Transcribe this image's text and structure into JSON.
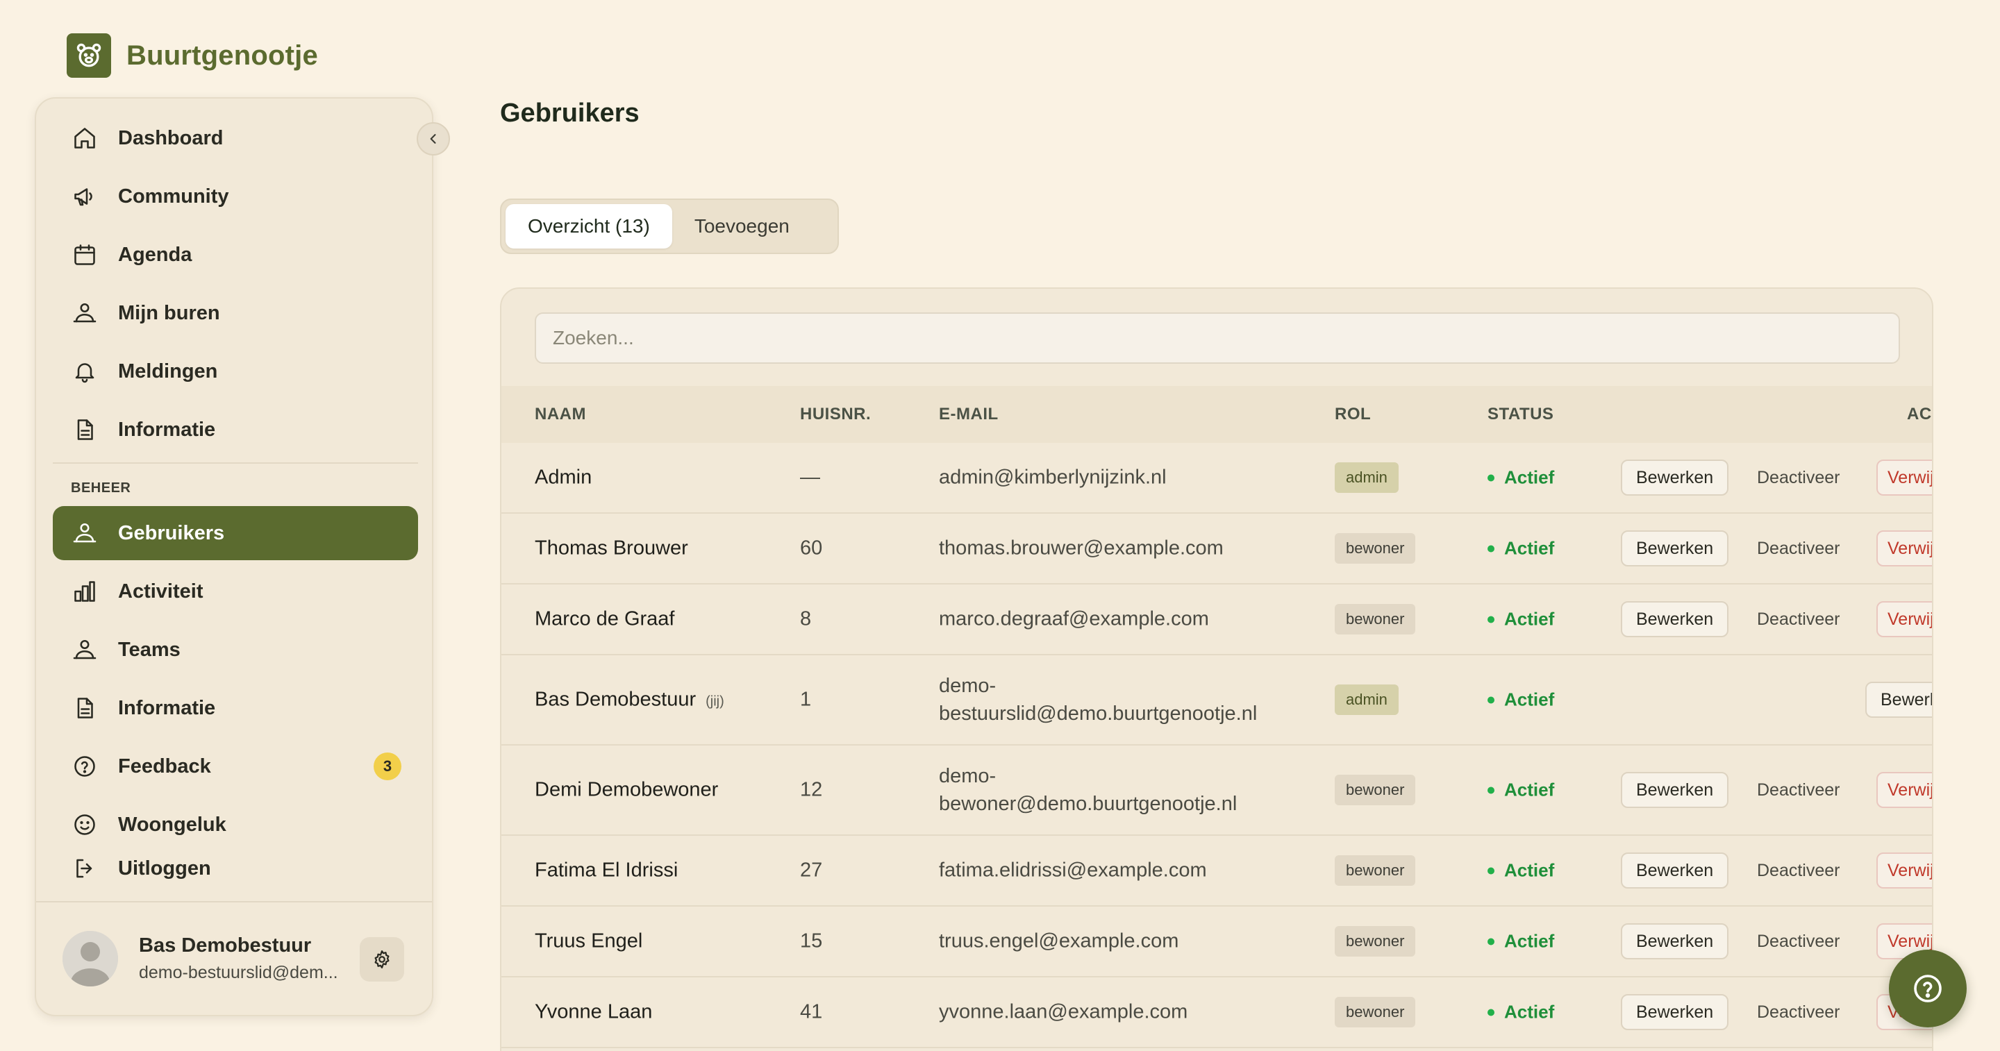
{
  "app": {
    "name": "Buurtgenootje"
  },
  "sidebar": {
    "items": [
      {
        "label": "Dashboard",
        "icon": "home-icon"
      },
      {
        "label": "Community",
        "icon": "megaphone-icon"
      },
      {
        "label": "Agenda",
        "icon": "calendar-icon"
      },
      {
        "label": "Mijn buren",
        "icon": "people-icon"
      },
      {
        "label": "Meldingen",
        "icon": "bell-icon"
      },
      {
        "label": "Informatie",
        "icon": "document-icon"
      }
    ],
    "section_title": "BEHEER",
    "admin_items": [
      {
        "label": "Gebruikers",
        "icon": "people-icon",
        "active": true
      },
      {
        "label": "Activiteit",
        "icon": "bar-chart-icon"
      },
      {
        "label": "Teams",
        "icon": "people-icon"
      },
      {
        "label": "Informatie",
        "icon": "document-icon"
      },
      {
        "label": "Feedback",
        "icon": "help-circle-icon",
        "badge": "3"
      },
      {
        "label": "Woongeluk",
        "icon": "smiley-icon"
      }
    ],
    "logout_label": "Uitloggen",
    "profile": {
      "name": "Bas Demobestuur",
      "email": "demo-bestuurslid@dem..."
    }
  },
  "main": {
    "title": "Gebruikers",
    "tabs": [
      {
        "label": "Overzicht (13)",
        "active": true
      },
      {
        "label": "Toevoegen"
      }
    ],
    "search_placeholder": "Zoeken...",
    "columns": {
      "name": "NAAM",
      "nr": "HUISNR.",
      "mail": "E-MAIL",
      "role": "ROL",
      "status": "STATUS",
      "actions": "AC"
    },
    "rows": [
      {
        "name": "Admin",
        "nr": "—",
        "email": "admin@kimberlynijzink.nl",
        "role": "admin",
        "status": "Actief"
      },
      {
        "name": "Thomas Brouwer",
        "nr": "60",
        "email": "thomas.brouwer@example.com",
        "role": "bewoner",
        "status": "Actief"
      },
      {
        "name": "Marco de Graaf",
        "nr": "8",
        "email": "marco.degraaf@example.com",
        "role": "bewoner",
        "status": "Actief"
      },
      {
        "name": "Bas Demobestuur",
        "self_tag": "(jij)",
        "nr": "1",
        "email_line1": "demo-",
        "email_line2": "bestuurslid@demo.buurtgenootje.nl",
        "role": "admin",
        "status": "Actief"
      },
      {
        "name": "Demi Demobewoner",
        "nr": "12",
        "email_line1": "demo-",
        "email_line2": "bewoner@demo.buurtgenootje.nl",
        "role": "bewoner",
        "status": "Actief"
      },
      {
        "name": "Fatima El Idrissi",
        "nr": "27",
        "email": "fatima.elidrissi@example.com",
        "role": "bewoner",
        "status": "Actief"
      },
      {
        "name": "Truus Engel",
        "nr": "15",
        "email": "truus.engel@example.com",
        "role": "bewoner",
        "status": "Actief"
      },
      {
        "name": "Yvonne Laan",
        "nr": "41",
        "email": "yvonne.laan@example.com",
        "role": "bewoner",
        "status": "Actief"
      }
    ],
    "actions": {
      "edit": "Bewerken",
      "edit_cut": "Bewerl",
      "deactivate": "Deactiveer",
      "delete": "Verwij"
    }
  },
  "colors": {
    "accent": "#5b6b2f",
    "background": "#faf2e3",
    "active_status": "#1f8f3a",
    "badge": "#f2cf4a",
    "danger": "#c0392b"
  }
}
